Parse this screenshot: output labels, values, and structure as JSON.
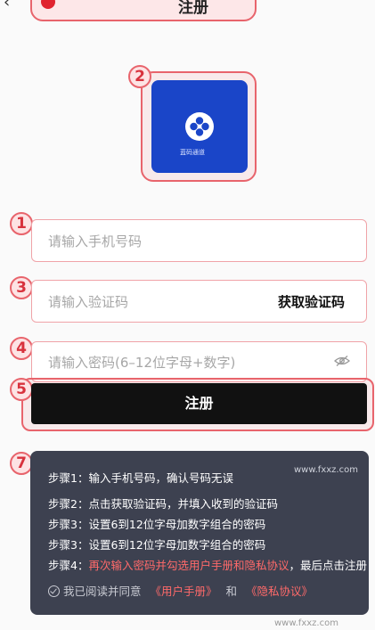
{
  "header": {
    "title": "注册",
    "back_icon": "chevron-left-icon"
  },
  "logo": {
    "caption": "蓝码通道",
    "tile_color": "#1a45c8"
  },
  "markers": [
    "1",
    "2",
    "3",
    "4",
    "5",
    "7"
  ],
  "form": {
    "phone_placeholder": "请输入手机号码",
    "code_placeholder": "请输入验证码",
    "get_code_label": "获取验证码",
    "password_placeholder": "请输入密码(6–12位字母+数字)",
    "password_toggle_icon": "eye-off-icon",
    "submit_label": "注册"
  },
  "instructions": {
    "steps": [
      {
        "prefix": "步骤1：",
        "text": "输入手机号码，确认号码无误"
      },
      {
        "prefix": "步骤2：",
        "text": "点击获取验证码，并填入收到的验证码"
      },
      {
        "prefix": "步骤3：",
        "text": "设置6到12位字母加数字组合的密码"
      },
      {
        "prefix": "步骤3：",
        "text": "设置6到12位字母加数字组合的密码"
      },
      {
        "prefix": "步骤4：",
        "text_red": "再次输入密码并勾选用户手册和隐私协议",
        "text": "，最后点击注册"
      }
    ],
    "agree_text": "我已阅读并同意",
    "user_manual": "《用户手册》",
    "and": "和",
    "privacy": "《隐私协议》",
    "watermark": "www.fxxz.com"
  },
  "footer_watermark": "www.fxxz.com",
  "colors": {
    "highlight": "#e8646c",
    "accent_red": "#ff6a6a",
    "panel": "#3d4150"
  }
}
